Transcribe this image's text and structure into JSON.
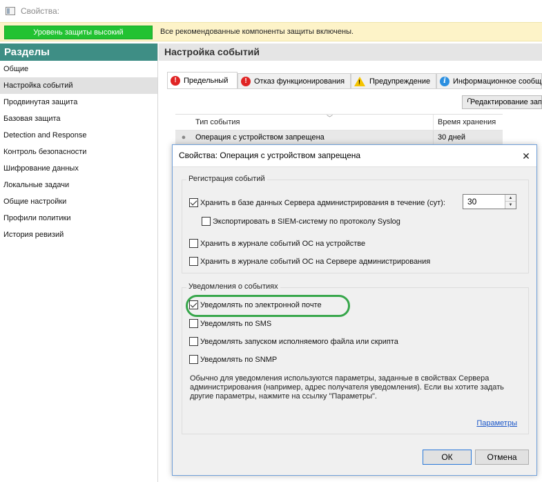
{
  "window": {
    "title": "Свойства:",
    "icon": "window-icon"
  },
  "status": {
    "level_label": "Уровень защиты высокий",
    "message": "Все рекомендованные компоненты защиты включены.",
    "level_color": "#22c232",
    "bar_color": "#fdf3c8"
  },
  "sidebar": {
    "header": "Разделы",
    "header_color": "#3e8e85",
    "items": [
      {
        "label": "Общие"
      },
      {
        "label": "Настройка событий",
        "active": true
      },
      {
        "label": "Продвинутая защита"
      },
      {
        "label": "Базовая защита"
      },
      {
        "label": "Detection and Response"
      },
      {
        "label": "Контроль безопасности"
      },
      {
        "label": "Шифрование данных"
      },
      {
        "label": "Локальные задачи"
      },
      {
        "label": "Общие настройки"
      },
      {
        "label": "Профили политики"
      },
      {
        "label": "История ревизий"
      }
    ]
  },
  "main": {
    "title": "Настройка событий",
    "tabs": [
      {
        "label": "Предельный",
        "icon": "critical-icon",
        "active": true
      },
      {
        "label": "Отказ функционирования",
        "icon": "error-icon"
      },
      {
        "label": "Предупреждение",
        "icon": "warning-icon"
      },
      {
        "label": "Информационное сообщение",
        "icon": "info-icon"
      }
    ],
    "edit_button": "Редактирование запрещено",
    "table": {
      "columns": [
        "Тип события",
        "Время хранения"
      ],
      "rows": [
        {
          "type": "Операция с устройством запрещена",
          "retention": "30 дней"
        }
      ]
    }
  },
  "dialog": {
    "title": "Свойства: Операция с устройством запрещена",
    "registration": {
      "legend": "Регистрация событий",
      "store_db": {
        "label": "Хранить в базе данных Сервера администрирования в течение (сут):",
        "checked": true,
        "days": "30"
      },
      "export_siem": {
        "label": "Экспортировать в SIEM-систему по протоколу Syslog",
        "checked": false
      },
      "store_os_device": {
        "label": "Хранить в журнале событий ОС на устройстве",
        "checked": false
      },
      "store_os_server": {
        "label": "Хранить в журнале событий ОС на Сервере администрирования",
        "checked": false
      }
    },
    "notifications": {
      "legend": "Уведомления о событиях",
      "email": {
        "label": "Уведомлять по электронной почте",
        "checked": true
      },
      "sms": {
        "label": "Уведомлять по SMS",
        "checked": false
      },
      "exec": {
        "label": "Уведомлять запуском исполняемого файла или скрипта",
        "checked": false
      },
      "snmp": {
        "label": "Уведомлять по SNMP",
        "checked": false
      },
      "note": "Обычно для уведомления используются параметры, заданные в свойствах Сервера администрирования (например, адрес получателя уведомления). Если вы хотите задать другие параметры, нажмите на ссылку \"Параметры\".",
      "params_link": "Параметры"
    },
    "ok": "ОК",
    "cancel": "Отмена"
  }
}
